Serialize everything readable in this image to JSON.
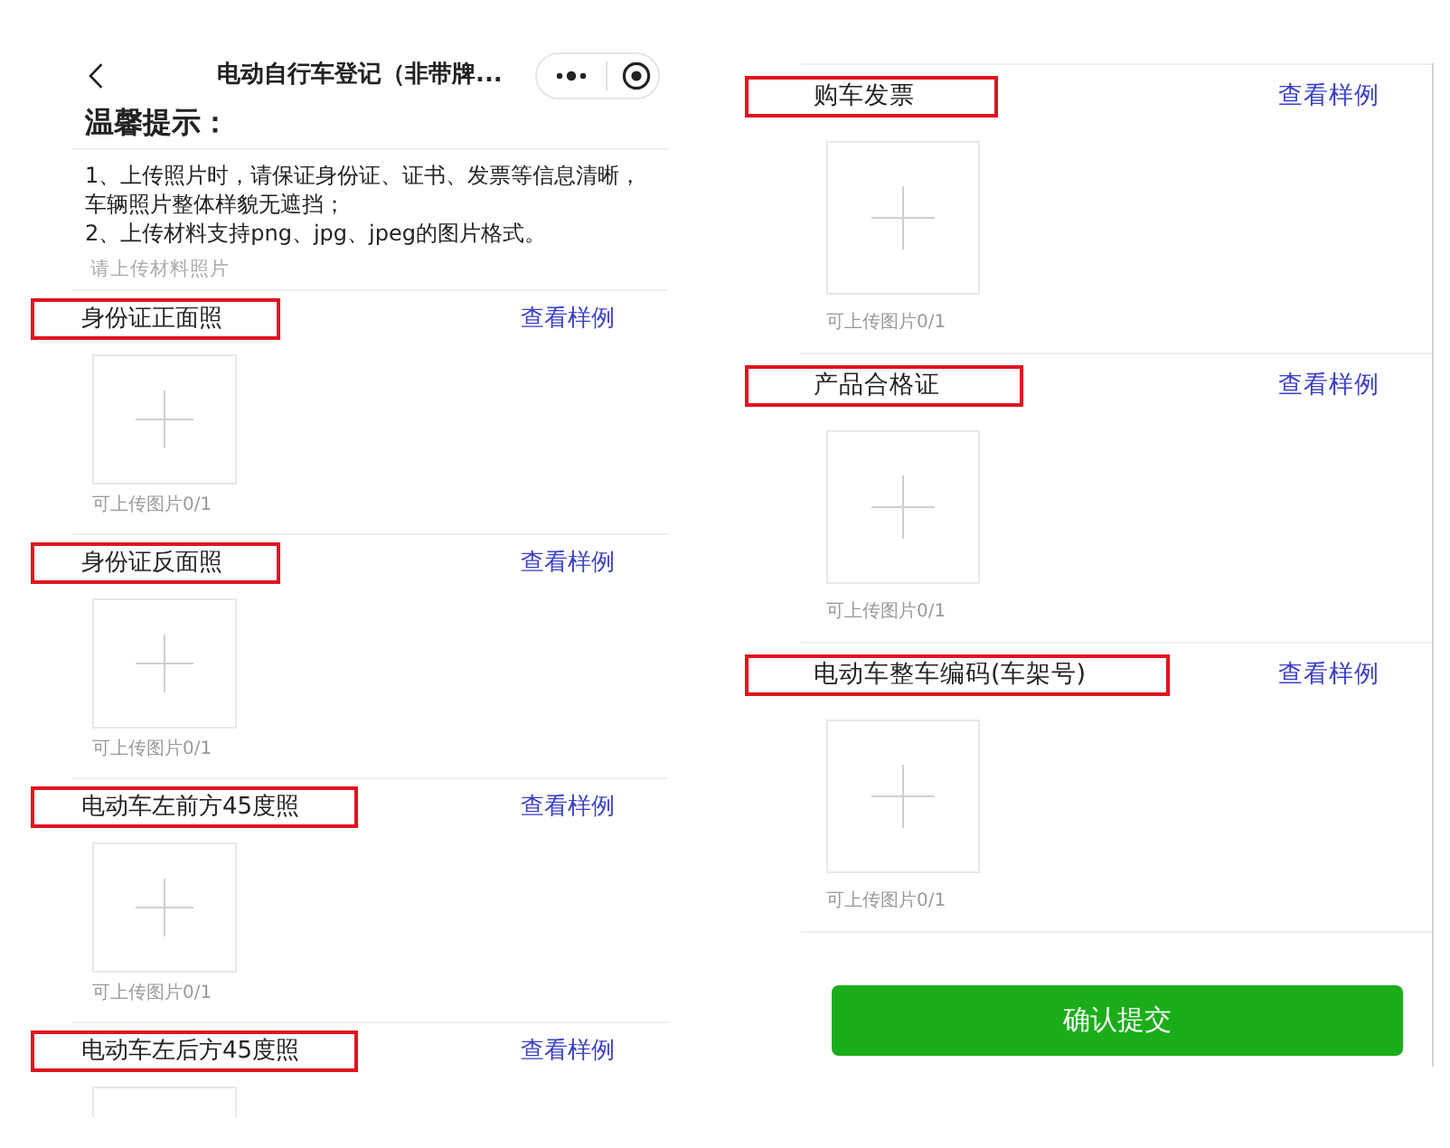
{
  "left_screen": {
    "nav_bar": {
      "title": "电动自行车登记（非带牌..."
    },
    "notice": {
      "heading": "温馨提示：",
      "lines": [
        "1、上传照片时，请保证身份证、证书、发票等信息清晰，车辆照片整体样貌无遮挡；",
        "2、上传材料支持png、jpg、jpeg的图片格式。"
      ]
    },
    "upload_hint": "请上传材料照片",
    "sections": [
      {
        "title": "身份证正面照",
        "highlighted": true,
        "link": "查看样例",
        "caption": "可上传图片0/1"
      },
      {
        "title": "身份证反面照",
        "highlighted": true,
        "link": "查看样例",
        "caption": "可上传图片0/1"
      },
      {
        "title": "电动车左前方45度照",
        "highlighted": true,
        "link": "查看样例",
        "caption": "可上传图片0/1"
      },
      {
        "title": "电动车左后方45度照",
        "highlighted": true,
        "link": "查看样例"
      }
    ]
  },
  "right_screen": {
    "sections": [
      {
        "title": "购车发票",
        "highlighted": true,
        "link": "查看样例",
        "caption": "可上传图片0/1"
      },
      {
        "title": "产品合格证",
        "highlighted": true,
        "link": "查看样例",
        "caption": "可上传图片0/1"
      },
      {
        "title": "电动车整车编码(车架号)",
        "highlighted": true,
        "link": "查看样例",
        "caption": "可上传图片0/1"
      }
    ],
    "submit_button": "确认提交"
  }
}
